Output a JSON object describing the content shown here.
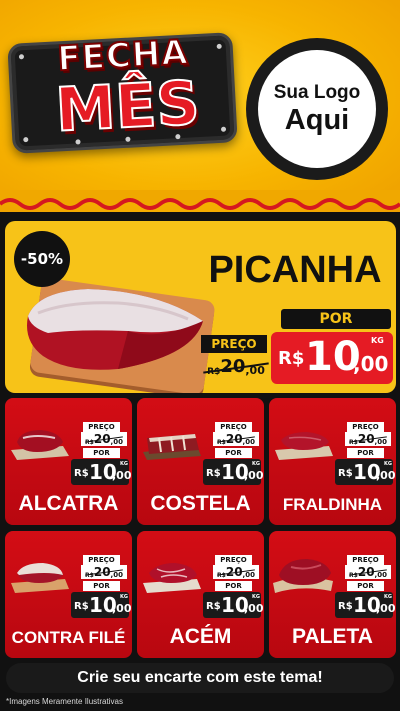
{
  "header": {
    "badge_line1": "FECHA",
    "badge_line2": "MÊS",
    "logo_line1": "Sua Logo",
    "logo_line2": "Aqui"
  },
  "hero": {
    "discount": "-50%",
    "title": "PICANHA",
    "preco_label": "PREÇO",
    "old_currency": "R$",
    "old_int": "20",
    "old_dec": ",00",
    "por_label": "POR",
    "currency": "R$",
    "price_int": "10",
    "price_dec": ",00",
    "unit": "KG"
  },
  "products": [
    {
      "name": "ALCATRA",
      "preco_label": "PREÇO",
      "old_currency": "R$",
      "old_int": "20",
      "old_dec": ",00",
      "por_label": "POR",
      "currency": "R$",
      "price_int": "10",
      "price_dec": ",00",
      "unit": "KG"
    },
    {
      "name": "COSTELA",
      "preco_label": "PREÇO",
      "old_currency": "R$",
      "old_int": "20",
      "old_dec": ",00",
      "por_label": "POR",
      "currency": "R$",
      "price_int": "10",
      "price_dec": ",00",
      "unit": "KG"
    },
    {
      "name": "FRALDINHA",
      "preco_label": "PREÇO",
      "old_currency": "R$",
      "old_int": "20",
      "old_dec": ",00",
      "por_label": "POR",
      "currency": "R$",
      "price_int": "10",
      "price_dec": ",00",
      "unit": "KG"
    },
    {
      "name": "CONTRA FILÉ",
      "preco_label": "PREÇO",
      "old_currency": "R$",
      "old_int": "20",
      "old_dec": ",00",
      "por_label": "POR",
      "currency": "R$",
      "price_int": "10",
      "price_dec": ",00",
      "unit": "KG"
    },
    {
      "name": "ACÉM",
      "preco_label": "PREÇO",
      "old_currency": "R$",
      "old_int": "20",
      "old_dec": ",00",
      "por_label": "POR",
      "currency": "R$",
      "price_int": "10",
      "price_dec": ",00",
      "unit": "KG"
    },
    {
      "name": "PALETA",
      "preco_label": "PREÇO",
      "old_currency": "R$",
      "old_int": "20",
      "old_dec": ",00",
      "por_label": "POR",
      "currency": "R$",
      "price_int": "10",
      "price_dec": ",00",
      "unit": "KG"
    }
  ],
  "footer": {
    "cta": "Crie seu encarte com este tema!",
    "disclaimer": "*Imagens Meramente Ilustrativas"
  },
  "colors": {
    "yellow": "#f7c318",
    "red": "#e51b24",
    "dark": "#1a1a1a"
  }
}
